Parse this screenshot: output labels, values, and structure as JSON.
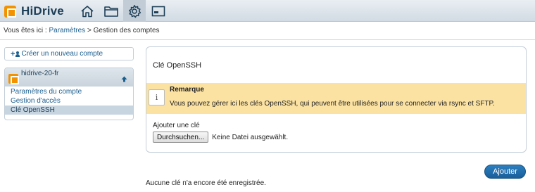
{
  "app": {
    "title": "HiDrive"
  },
  "topbar": {
    "icons": [
      "home-icon",
      "folder-icon",
      "gear-icon",
      "screen-icon"
    ],
    "active": "gear-icon"
  },
  "breadcrumb": {
    "prefix": "Vous êtes ici :",
    "parent": "Paramètres",
    "separator": ">",
    "current": "Gestion des comptes"
  },
  "sidebar": {
    "new_account": "Créer un nouveau compte",
    "account_name": "hidrive-20-fr",
    "items": [
      {
        "label": "Paramètres du compte"
      },
      {
        "label": "Gestion d'accès"
      },
      {
        "label": "Clé OpenSSH",
        "active": true
      }
    ]
  },
  "panel": {
    "title": "Clé OpenSSH",
    "notice": {
      "icon": "i",
      "title": "Remarque",
      "text": "Vous pouvez gérer ici les clés OpenSSH, qui peuvent être utilisées pour se connecter via rsync et SFTP."
    },
    "add_key_label": "Ajouter une clé",
    "browse_button": "Durchsuchen...",
    "file_status": "Keine Datei ausgewählt."
  },
  "actions": {
    "add_button": "Ajouter"
  },
  "empty_message": "Aucune clé n'a encore été enregistrée.",
  "colors": {
    "accent": "#1a5e8e",
    "brand": "#f39200",
    "notice_bg": "#fbe2a3",
    "button": "#1f6aa8"
  }
}
